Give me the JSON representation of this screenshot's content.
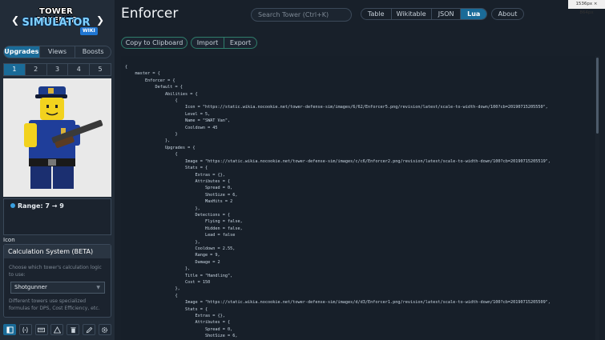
{
  "screen": "1536px × 864px",
  "sidebar": {
    "logo_line1": "TOWER DEFENSE",
    "logo_line2": "SIMULATOR",
    "logo_badge": "WIKI",
    "tabs": [
      {
        "label": "Upgrades"
      },
      {
        "label": "Views"
      },
      {
        "label": "Boosts"
      }
    ],
    "levels": [
      "1",
      "2",
      "3",
      "4",
      "5"
    ],
    "range_text": "Range: 7 → 9",
    "icon_caption": "Icon",
    "calc": {
      "title": "Calculation System (BETA)",
      "description": "Choose which tower's calculation logic to use:",
      "selected": "Shotgunner",
      "note": "Different towers use specialized formulas for DPS, Cost Efficiency, etc."
    }
  },
  "header": {
    "title": "Enforcer",
    "search_placeholder": "Search Tower (Ctrl+K)",
    "view_tabs": [
      {
        "label": "Table"
      },
      {
        "label": "Wikitable"
      },
      {
        "label": "JSON"
      },
      {
        "label": "Lua",
        "active": true
      }
    ],
    "about_label": "About"
  },
  "actions": {
    "copy": "Copy to Clipboard",
    "import": "Import",
    "export": "Export"
  },
  "code_lines": [
    "{",
    "    master = {",
    "        Enforcer = {",
    "            Default = {",
    "                Abilities = {",
    "                    {",
    "                        Icon = \"https://static.wikia.nocookie.net/tower-defense-sim/images/6/62/Enforcer5.png/revision/latest/scale-to-width-down/100?cb=20190715205550\",",
    "                        Level = 5,",
    "                        Name = \"SWAT Van\",",
    "                        Cooldown = 45",
    "                    }",
    "                },",
    "                Upgrades = {",
    "                    {",
    "                        Image = \"https://static.wikia.nocookie.net/tower-defense-sim/images/c/c6/Enforcer2.png/revision/latest/scale-to-width-down/100?cb=20190715205519\",",
    "                        Stats = {",
    "                            Extras = {},",
    "                            Attributes = {",
    "                                Spread = 0,",
    "                                ShotSize = 6,",
    "                                MaxHits = 2",
    "                            },",
    "                            Detections = {",
    "                                Flying = false,",
    "                                Hidden = false,",
    "                                Lead = false",
    "                            },",
    "                            Cooldown = 2.55,",
    "                            Range = 9,",
    "                            Damage = 2",
    "                        },",
    "                        Title = \"Handling\",",
    "                        Cost = 150",
    "                    },",
    "                    {",
    "                        Image = \"https://static.wikia.nocookie.net/tower-defense-sim/images/d/d3/Enforcer1.png/revision/latest/scale-to-width-down/100?cb=20190715205509\",",
    "                        Stats = {",
    "                            Extras = {},",
    "                            Attributes = {",
    "                                Spread = 0,",
    "                                ShotSize = 6,"
  ]
}
